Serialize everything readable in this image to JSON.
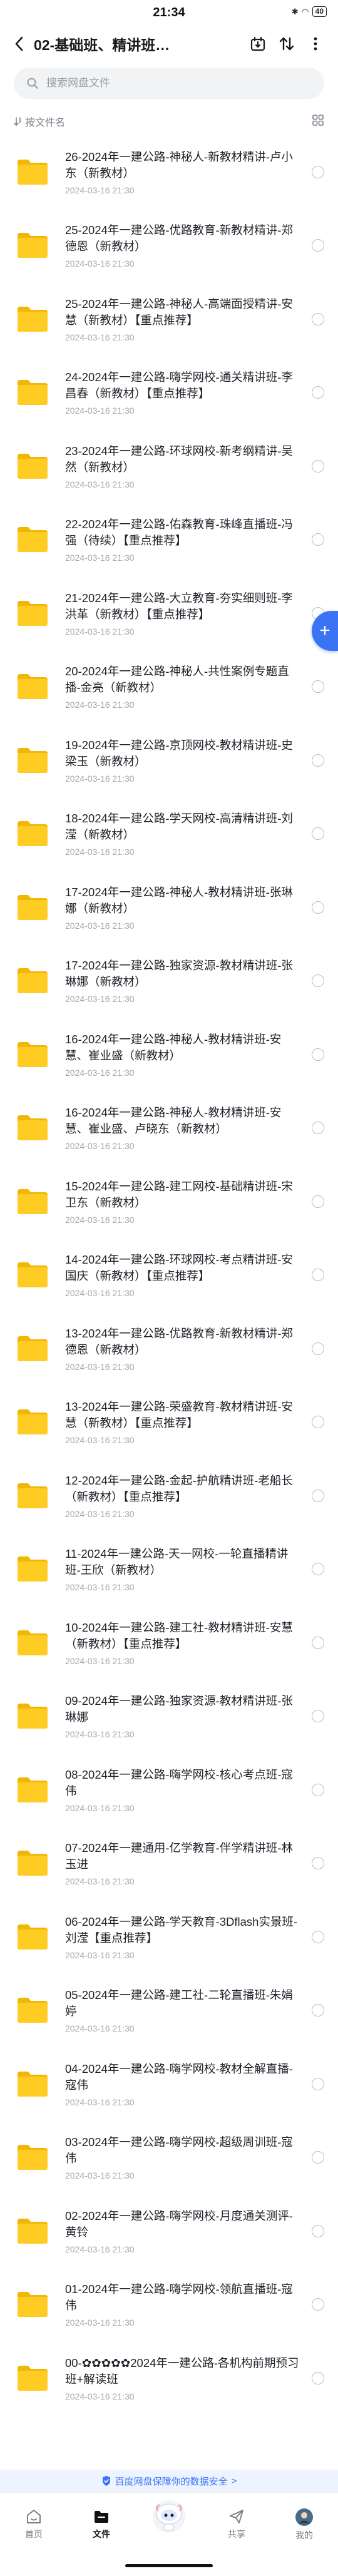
{
  "status": {
    "time": "21:34",
    "battery": "40"
  },
  "header": {
    "title": "02-基础班、精讲班…"
  },
  "search": {
    "placeholder": "搜索网盘文件"
  },
  "sort": {
    "label": "按文件名"
  },
  "colors": {
    "accent": "#3a74f5",
    "folder": "#f7c21a"
  },
  "files": [
    {
      "name": "26-2024年一建公路-神秘人-新教材精讲-卢小东（新教材）",
      "date": "2024-03-16  21:30"
    },
    {
      "name": "25-2024年一建公路-优路教育-新教材精讲-郑德恩（新教材）",
      "date": "2024-03-16  21:30"
    },
    {
      "name": "25-2024年一建公路-神秘人-高端面授精讲-安慧（新教材）【重点推荐】",
      "date": "2024-03-16  21:30"
    },
    {
      "name": "24-2024年一建公路-嗨学网校-通关精讲班-李昌春（新教材）【重点推荐】",
      "date": "2024-03-16  21:30"
    },
    {
      "name": "23-2024年一建公路-环球网校-新考纲精讲-吴然（新教材）",
      "date": "2024-03-16  21:30"
    },
    {
      "name": "22-2024年一建公路-佑森教育-珠峰直播班-冯强（待续）【重点推荐】",
      "date": "2024-03-16  21:30"
    },
    {
      "name": "21-2024年一建公路-大立教育-夯实细则班-李洪革（新教材）【重点推荐】",
      "date": "2024-03-16  21:30"
    },
    {
      "name": "20-2024年一建公路-神秘人-共性案例专题直播-金亮（新教材）",
      "date": "2024-03-16  21:30"
    },
    {
      "name": "19-2024年一建公路-京顶网校-教材精讲班-史梁玉（新教材）",
      "date": "2024-03-16  21:30"
    },
    {
      "name": "18-2024年一建公路-学天网校-高清精讲班-刘滢（新教材）",
      "date": "2024-03-16  21:30"
    },
    {
      "name": "17-2024年一建公路-神秘人-教材精讲班-张琳娜（新教材）",
      "date": "2024-03-16  21:30"
    },
    {
      "name": "17-2024年一建公路-独家资源-教材精讲班-张琳娜（新教材）",
      "date": "2024-03-16  21:30"
    },
    {
      "name": "16-2024年一建公路-神秘人-教材精讲班-安慧、崔业盛（新教材）",
      "date": "2024-03-16  21:30"
    },
    {
      "name": "16-2024年一建公路-神秘人-教材精讲班-安慧、崔业盛、卢晓东（新教材）",
      "date": "2024-03-16  21:30"
    },
    {
      "name": "15-2024年一建公路-建工网校-基础精讲班-宋卫东（新教材）",
      "date": "2024-03-16  21:30"
    },
    {
      "name": "14-2024年一建公路-环球网校-考点精讲班-安国庆（新教材）【重点推荐】",
      "date": "2024-03-16  21:30"
    },
    {
      "name": "13-2024年一建公路-优路教育-新教材精讲-郑德恩（新教材）",
      "date": "2024-03-16  21:30"
    },
    {
      "name": "13-2024年一建公路-荣盛教育-教材精讲班-安慧（新教材）【重点推荐】",
      "date": "2024-03-16  21:30"
    },
    {
      "name": "12-2024年一建公路-金起-护航精讲班-老船长（新教材）【重点推荐】",
      "date": "2024-03-16  21:30"
    },
    {
      "name": "11-2024年一建公路-天一网校-一轮直播精讲班-王欣（新教材）",
      "date": "2024-03-16  21:30"
    },
    {
      "name": "10-2024年一建公路-建工社-教材精讲班-安慧（新教材）【重点推荐】",
      "date": "2024-03-16  21:30"
    },
    {
      "name": "09-2024年一建公路-独家资源-教材精讲班-张琳娜",
      "date": "2024-03-16  21:30"
    },
    {
      "name": "08-2024年一建公路-嗨学网校-核心考点班-寇伟",
      "date": "2024-03-16  21:30"
    },
    {
      "name": "07-2024年一建通用-亿学教育-伴学精讲班-林玉进",
      "date": "2024-03-16  21:30"
    },
    {
      "name": "06-2024年一建公路-学天教育-3Dflash实景班-刘滢【重点推荐】",
      "date": "2024-03-16  21:30"
    },
    {
      "name": "05-2024年一建公路-建工社-二轮直播班-朱娟婷",
      "date": "2024-03-16  21:30"
    },
    {
      "name": "04-2024年一建公路-嗨学网校-教材全解直播-寇伟",
      "date": "2024-03-16  21:30"
    },
    {
      "name": "03-2024年一建公路-嗨学网校-超级周训班-寇伟",
      "date": "2024-03-16  21:30"
    },
    {
      "name": "02-2024年一建公路-嗨学网校-月度通关测评-黄铃",
      "date": "2024-03-16  21:30"
    },
    {
      "name": "01-2024年一建公路-嗨学网校-领航直播班-寇伟",
      "date": "2024-03-16  21:30"
    },
    {
      "name": "00-✿✿✿✿✿2024年一建公路-各机构前期预习班+解读班",
      "date": "2024-03-16  21:30"
    }
  ],
  "notice": {
    "text": "百度网盘保障你的数据安全",
    "arrow": ">"
  },
  "tabs": [
    {
      "label": "首页",
      "icon": "home-icon"
    },
    {
      "label": "文件",
      "icon": "folder-tab-icon"
    },
    {
      "label": "",
      "icon": "mascot-icon"
    },
    {
      "label": "共享",
      "icon": "share-icon"
    },
    {
      "label": "我的",
      "icon": "avatar-icon"
    }
  ]
}
